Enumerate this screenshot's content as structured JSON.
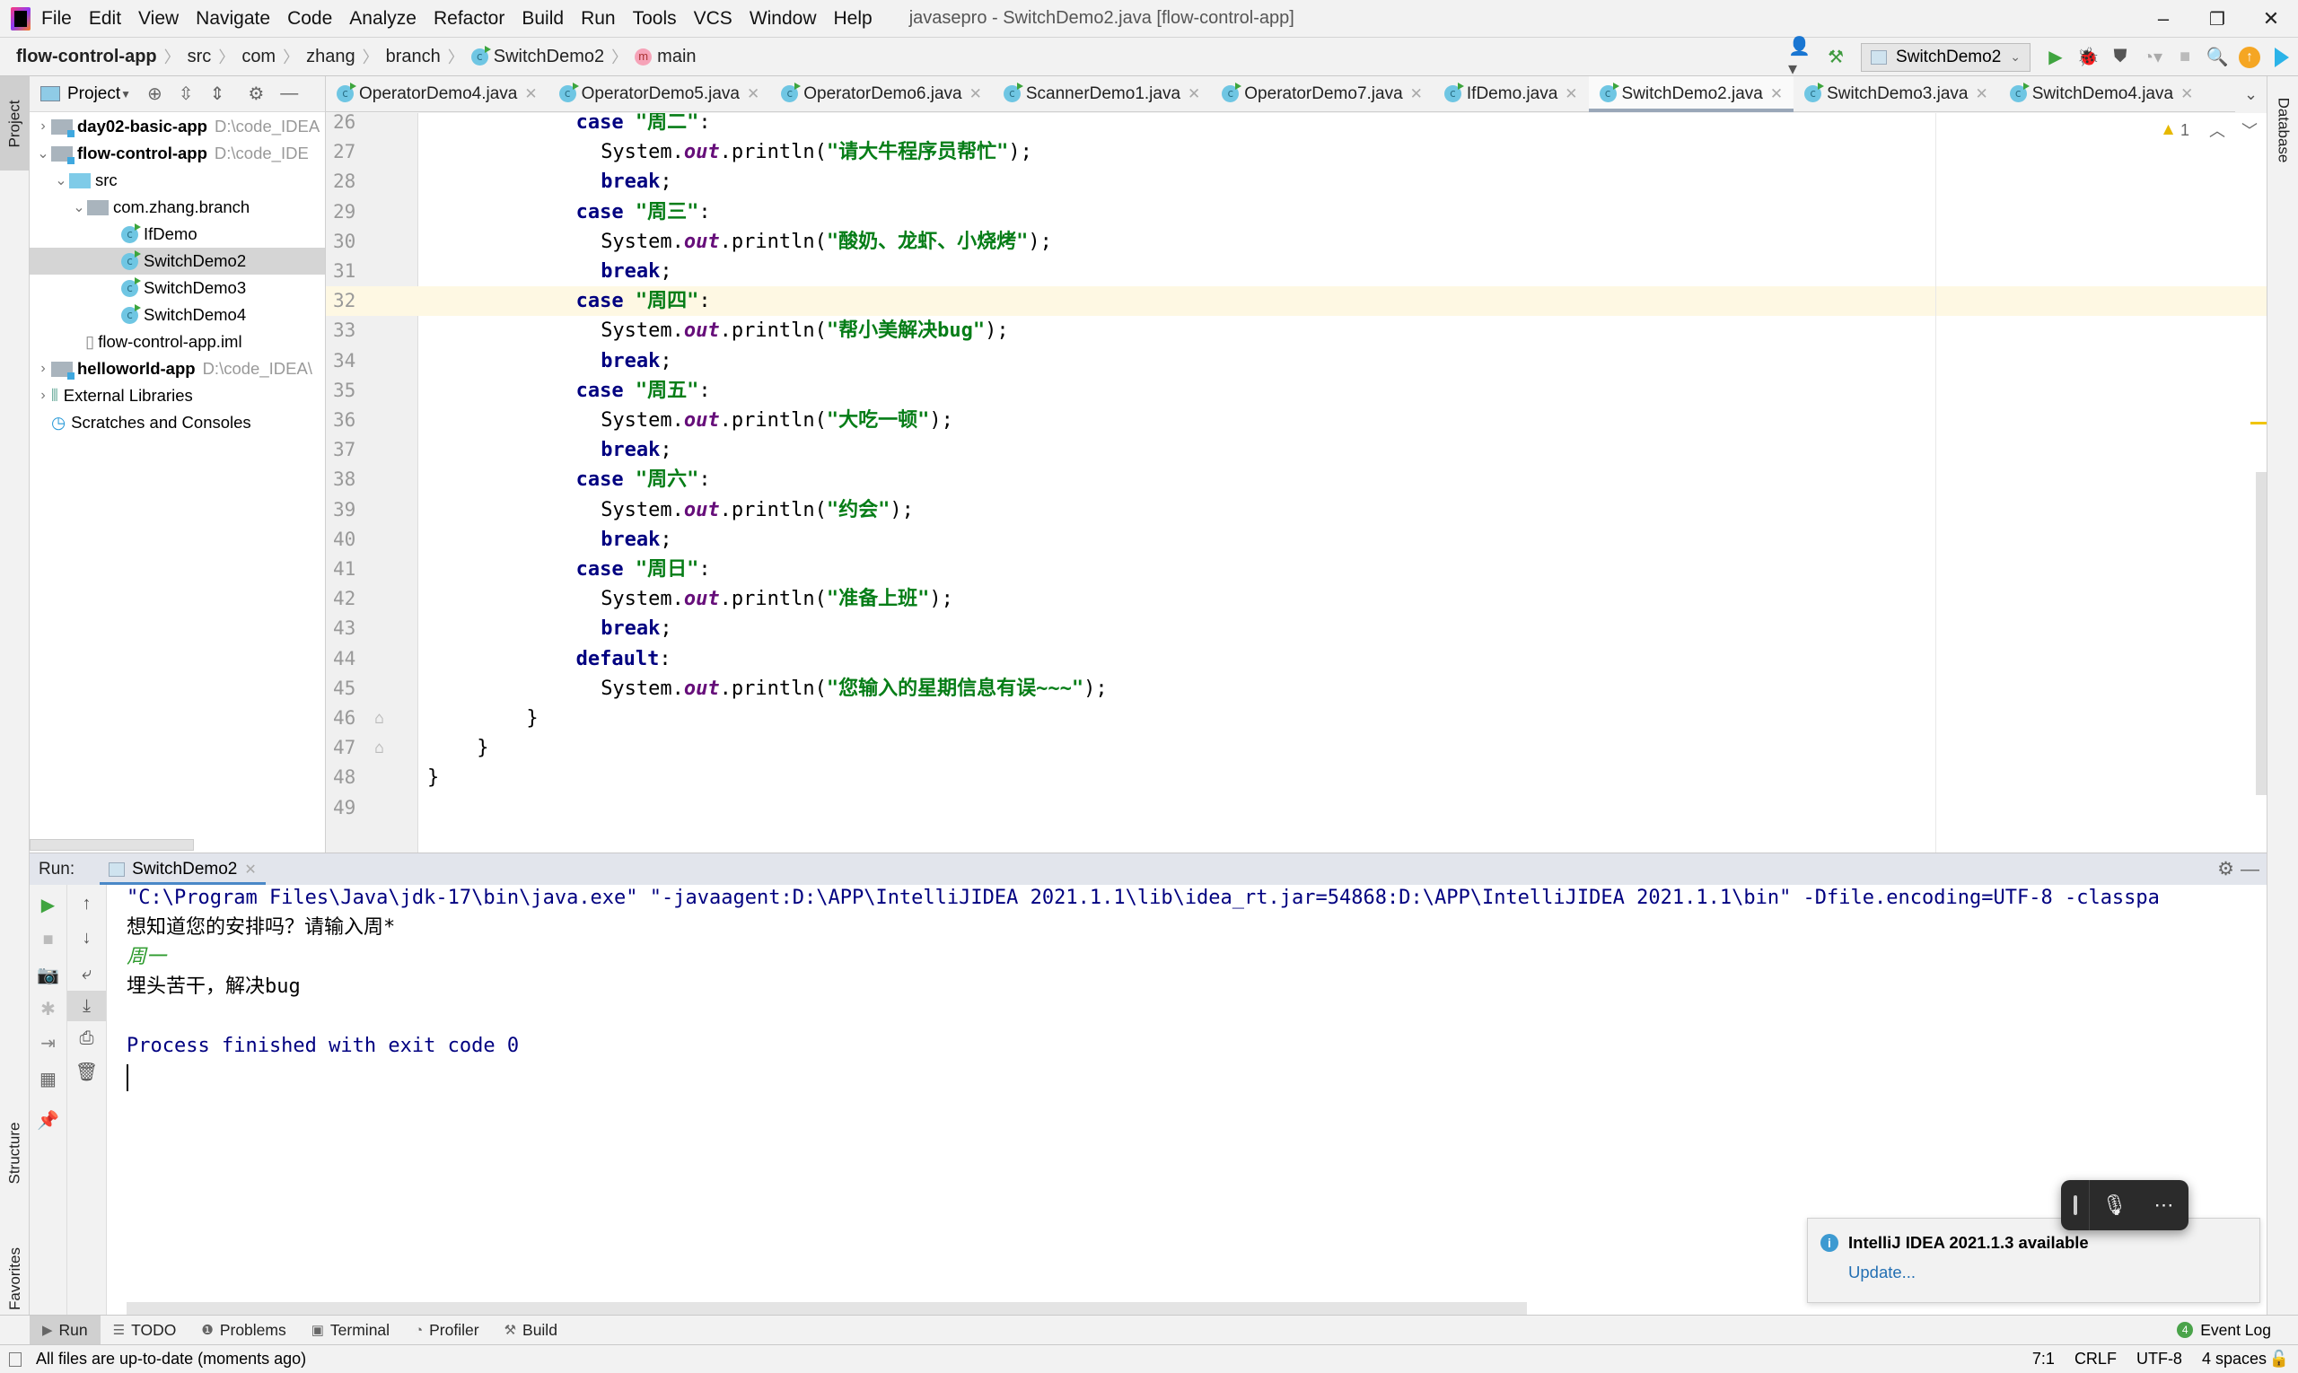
{
  "window": {
    "title": "javasepro - SwitchDemo2.java [flow-control-app]",
    "menu": [
      "File",
      "Edit",
      "View",
      "Navigate",
      "Code",
      "Analyze",
      "Refactor",
      "Build",
      "Run",
      "Tools",
      "VCS",
      "Window",
      "Help"
    ],
    "controls": {
      "minimize": "–",
      "restore": "❐",
      "close": "✕"
    }
  },
  "breadcrumb": [
    "flow-control-app",
    "src",
    "com",
    "zhang",
    "branch",
    "SwitchDemo2",
    "main"
  ],
  "toolbar": {
    "run_config": "SwitchDemo2",
    "icons": [
      "user-icon",
      "build-hammer-icon",
      "run-icon",
      "debug-icon",
      "coverage-icon",
      "profile-icon",
      "stop-icon",
      "search-icon",
      "update-icon",
      "toolbox-icon"
    ]
  },
  "left_stripe": {
    "project": "Project",
    "structure": "Structure",
    "favorites": "Favorites"
  },
  "right_stripe": {
    "database": "Database"
  },
  "project_panel": {
    "title": "Project",
    "tree": [
      {
        "label": "day02-basic-app",
        "path": "D:\\code_IDEA",
        "type": "module",
        "expanded": false,
        "level": 0
      },
      {
        "label": "flow-control-app",
        "path": "D:\\code_IDE",
        "type": "module",
        "expanded": true,
        "level": 0
      },
      {
        "label": "src",
        "type": "source-folder",
        "expanded": true,
        "level": 1
      },
      {
        "label": "com.zhang.branch",
        "type": "package",
        "expanded": true,
        "level": 2
      },
      {
        "label": "IfDemo",
        "type": "class",
        "level": 3
      },
      {
        "label": "SwitchDemo2",
        "type": "class",
        "level": 3,
        "selected": true
      },
      {
        "label": "SwitchDemo3",
        "type": "class",
        "level": 3
      },
      {
        "label": "SwitchDemo4",
        "type": "class",
        "level": 3
      },
      {
        "label": "flow-control-app.iml",
        "type": "file",
        "level": 1
      },
      {
        "label": "helloworld-app",
        "path": "D:\\code_IDEA\\",
        "type": "module",
        "expanded": false,
        "level": 0
      },
      {
        "label": "External Libraries",
        "type": "libraries",
        "expanded": false,
        "level": 0
      },
      {
        "label": "Scratches and Consoles",
        "type": "scratches",
        "level": 0
      }
    ]
  },
  "editor_tabs": [
    {
      "label": "OperatorDemo4.java"
    },
    {
      "label": "OperatorDemo5.java"
    },
    {
      "label": "OperatorDemo6.java"
    },
    {
      "label": "ScannerDemo1.java"
    },
    {
      "label": "OperatorDemo7.java"
    },
    {
      "label": "IfDemo.java"
    },
    {
      "label": "SwitchDemo2.java",
      "active": true
    },
    {
      "label": "SwitchDemo3.java"
    },
    {
      "label": "SwitchDemo4.java"
    }
  ],
  "editor": {
    "inspection_warnings": "1",
    "current_line": 32,
    "lines": [
      {
        "n": "26",
        "indent": 6,
        "tokens": [
          [
            "kw",
            "case "
          ],
          [
            "str",
            "\"周二\""
          ],
          [
            "pl",
            ":"
          ]
        ]
      },
      {
        "n": "27",
        "indent": 7,
        "tokens": [
          [
            "pl",
            "System."
          ],
          [
            "fld",
            "out"
          ],
          [
            "pl",
            ".println("
          ],
          [
            "str",
            "\"请大牛程序员帮忙\""
          ],
          [
            "pl",
            ");"
          ]
        ]
      },
      {
        "n": "28",
        "indent": 7,
        "tokens": [
          [
            "kw",
            "break"
          ],
          [
            "pl",
            ";"
          ]
        ]
      },
      {
        "n": "29",
        "indent": 6,
        "tokens": [
          [
            "kw",
            "case "
          ],
          [
            "str",
            "\"周三\""
          ],
          [
            "pl",
            ":"
          ]
        ]
      },
      {
        "n": "30",
        "indent": 7,
        "tokens": [
          [
            "pl",
            "System."
          ],
          [
            "fld",
            "out"
          ],
          [
            "pl",
            ".println("
          ],
          [
            "str",
            "\"酸奶、龙虾、小烧烤\""
          ],
          [
            "pl",
            ");"
          ]
        ]
      },
      {
        "n": "31",
        "indent": 7,
        "tokens": [
          [
            "kw",
            "break"
          ],
          [
            "pl",
            ";"
          ]
        ]
      },
      {
        "n": "32",
        "indent": 6,
        "tokens": [
          [
            "kw",
            "case "
          ],
          [
            "str",
            "\"周四\""
          ],
          [
            "pl",
            ":"
          ]
        ]
      },
      {
        "n": "33",
        "indent": 7,
        "tokens": [
          [
            "pl",
            "System."
          ],
          [
            "fld",
            "out"
          ],
          [
            "pl",
            ".println("
          ],
          [
            "str",
            "\"帮小美解决bug\""
          ],
          [
            "pl",
            ");"
          ]
        ]
      },
      {
        "n": "34",
        "indent": 7,
        "tokens": [
          [
            "kw",
            "break"
          ],
          [
            "pl",
            ";"
          ]
        ]
      },
      {
        "n": "35",
        "indent": 6,
        "tokens": [
          [
            "kw",
            "case "
          ],
          [
            "str",
            "\"周五\""
          ],
          [
            "pl",
            ":"
          ]
        ]
      },
      {
        "n": "36",
        "indent": 7,
        "tokens": [
          [
            "pl",
            "System."
          ],
          [
            "fld",
            "out"
          ],
          [
            "pl",
            ".println("
          ],
          [
            "str",
            "\"大吃一顿\""
          ],
          [
            "pl",
            ");"
          ]
        ]
      },
      {
        "n": "37",
        "indent": 7,
        "tokens": [
          [
            "kw",
            "break"
          ],
          [
            "pl",
            ";"
          ]
        ]
      },
      {
        "n": "38",
        "indent": 6,
        "tokens": [
          [
            "kw",
            "case "
          ],
          [
            "str",
            "\"周六\""
          ],
          [
            "pl",
            ":"
          ]
        ]
      },
      {
        "n": "39",
        "indent": 7,
        "tokens": [
          [
            "pl",
            "System."
          ],
          [
            "fld",
            "out"
          ],
          [
            "pl",
            ".println("
          ],
          [
            "str",
            "\"约会\""
          ],
          [
            "pl",
            ");"
          ]
        ]
      },
      {
        "n": "40",
        "indent": 7,
        "tokens": [
          [
            "kw",
            "break"
          ],
          [
            "pl",
            ";"
          ]
        ]
      },
      {
        "n": "41",
        "indent": 6,
        "tokens": [
          [
            "kw",
            "case "
          ],
          [
            "str",
            "\"周日\""
          ],
          [
            "pl",
            ":"
          ]
        ]
      },
      {
        "n": "42",
        "indent": 7,
        "tokens": [
          [
            "pl",
            "System."
          ],
          [
            "fld",
            "out"
          ],
          [
            "pl",
            ".println("
          ],
          [
            "str",
            "\"准备上班\""
          ],
          [
            "pl",
            ");"
          ]
        ]
      },
      {
        "n": "43",
        "indent": 7,
        "tokens": [
          [
            "kw",
            "break"
          ],
          [
            "pl",
            ";"
          ]
        ]
      },
      {
        "n": "44",
        "indent": 6,
        "tokens": [
          [
            "kw",
            "default"
          ],
          [
            "pl",
            ":"
          ]
        ]
      },
      {
        "n": "45",
        "indent": 7,
        "tokens": [
          [
            "pl",
            "System."
          ],
          [
            "fld",
            "out"
          ],
          [
            "pl",
            ".println("
          ],
          [
            "str",
            "\"您输入的星期信息有误~~~\""
          ],
          [
            "pl",
            ");"
          ]
        ]
      },
      {
        "n": "46",
        "indent": 4,
        "tokens": [
          [
            "pl",
            "}"
          ]
        ]
      },
      {
        "n": "47",
        "indent": 2,
        "tokens": [
          [
            "pl",
            "}"
          ]
        ]
      },
      {
        "n": "48",
        "indent": 0,
        "tokens": [
          [
            "pl",
            "}"
          ]
        ]
      },
      {
        "n": "49",
        "indent": 0,
        "tokens": []
      }
    ]
  },
  "run_panel": {
    "label": "Run:",
    "tab": "SwitchDemo2",
    "console": [
      {
        "text": "\"C:\\Program Files\\Java\\jdk-17\\bin\\java.exe\" \"-javaagent:D:\\APP\\IntelliJIDEA 2021.1.1\\lib\\idea_rt.jar=54868:D:\\APP\\IntelliJIDEA 2021.1.1\\bin\" -Dfile.encoding=UTF-8 -classpa",
        "kind": "cmd"
      },
      {
        "text": "想知道您的安排吗？请输入周*",
        "kind": "out"
      },
      {
        "text": "周一",
        "kind": "input"
      },
      {
        "text": "埋头苦干，解决bug",
        "kind": "out"
      },
      {
        "text": "",
        "kind": "out"
      },
      {
        "text": "Process finished with exit code 0",
        "kind": "cmd"
      }
    ]
  },
  "bottom_tabs": [
    "Run",
    "TODO",
    "Problems",
    "Terminal",
    "Profiler",
    "Build"
  ],
  "event_log": {
    "label": "Event Log",
    "count": "4"
  },
  "status": {
    "message": "All files are up-to-date (moments ago)",
    "position": "7:1",
    "line_sep": "CRLF",
    "encoding": "UTF-8",
    "indent": "4 spaces"
  },
  "notification": {
    "title": "IntelliJ IDEA 2021.1.3 available",
    "action": "Update..."
  },
  "colors": {
    "keyword": "#000080",
    "string": "#067d17",
    "field": "#660e7a",
    "console_cmd": "#000080",
    "console_input": "#2e9b2e",
    "link": "#2470b3",
    "current_line": "#fef8e3"
  }
}
